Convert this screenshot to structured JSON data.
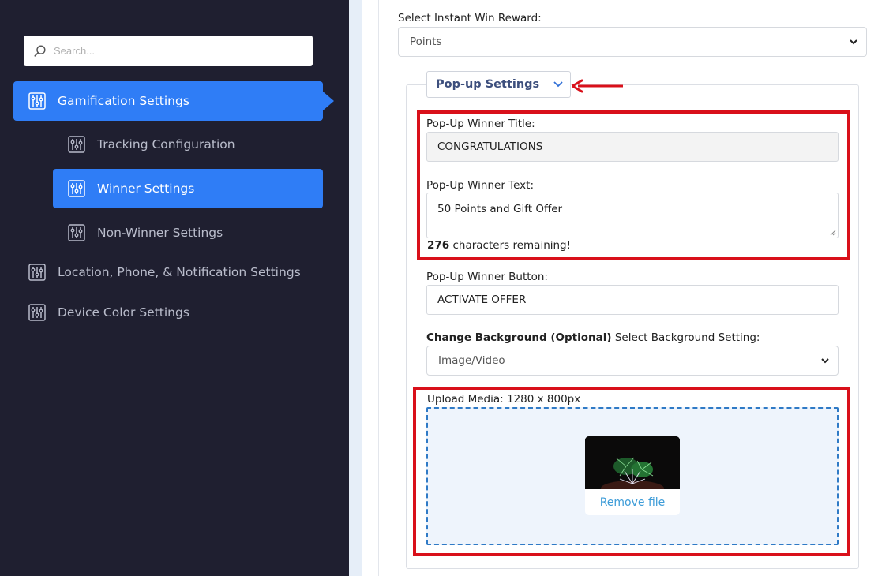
{
  "sidebar": {
    "search_placeholder": "Search...",
    "items": [
      {
        "label": "Gamification Settings"
      },
      {
        "label": "Tracking Configuration"
      },
      {
        "label": "Winner Settings"
      },
      {
        "label": "Non-Winner Settings"
      },
      {
        "label": "Location, Phone, & Notification Settings"
      },
      {
        "label": "Device Color Settings"
      }
    ]
  },
  "form": {
    "reward_label": "Select Instant Win Reward:",
    "reward_value": "Points",
    "popup_toggle_label": "Pop-up Settings",
    "winner_title_label": "Pop-Up Winner Title:",
    "winner_title_value": "CONGRATULATIONS",
    "winner_text_label": "Pop-Up Winner Text:",
    "winner_text_value": "50 Points and Gift Offer",
    "chars_remaining_count": "276",
    "chars_remaining_text": "characters remaining!",
    "winner_button_label": "Pop-Up Winner Button:",
    "winner_button_value": "ACTIVATE OFFER",
    "background_label_bold": "Change Background (Optional)",
    "background_label_rest": "Select Background Setting:",
    "background_value": "Image/Video",
    "upload_label": "Upload Media: 1280 x 800px",
    "remove_file": "Remove file"
  },
  "colors": {
    "sidebar_bg": "#1f1f30",
    "accent": "#2f7df6",
    "highlight_red": "#d9101a",
    "link_blue": "#3d9cd8"
  }
}
